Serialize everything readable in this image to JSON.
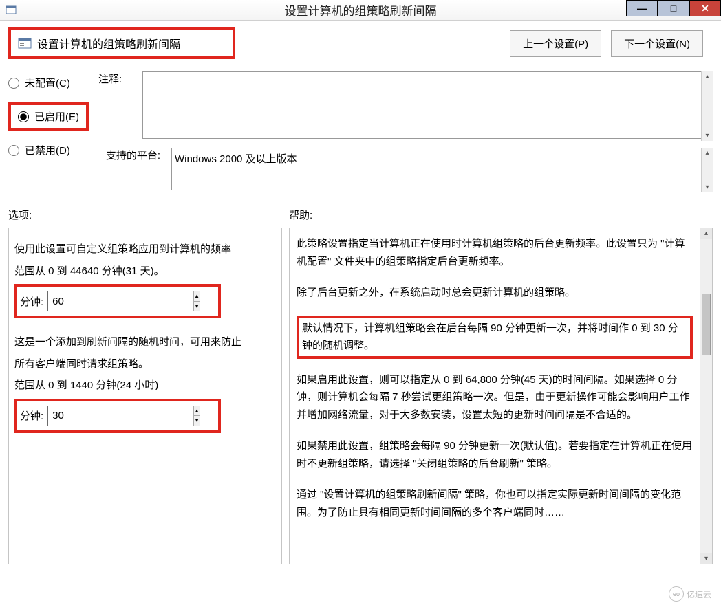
{
  "window": {
    "title": "设置计算机的组策略刷新间隔"
  },
  "header": {
    "policy_name": "设置计算机的组策略刷新间隔",
    "prev_button": "上一个设置(P)",
    "next_button": "下一个设置(N)"
  },
  "state": {
    "not_configured": "未配置(C)",
    "enabled": "已启用(E)",
    "disabled": "已禁用(D)",
    "selected": "enabled"
  },
  "comment": {
    "label": "注释:",
    "value": ""
  },
  "supported": {
    "label": "支持的平台:",
    "value": "Windows 2000 及以上版本"
  },
  "options": {
    "section_label": "选项:",
    "desc1": "使用此设置可自定义组策略应用到计算机的频率",
    "range1": "范围从 0 到 44640 分钟(31 天)。",
    "minute_label": "分钟:",
    "interval_value": "60",
    "desc2": "这是一个添加到刷新间隔的随机时间，可用来防止",
    "desc3": "所有客户端同时请求组策略。",
    "range2": "范围从 0 到 1440 分钟(24 小时)",
    "offset_value": "30"
  },
  "help": {
    "section_label": "帮助:",
    "p1": "此策略设置指定当计算机正在使用时计算机组策略的后台更新频率。此设置只为 \"计算机配置\" 文件夹中的组策略指定后台更新频率。",
    "p2": "除了后台更新之外，在系统启动时总会更新计算机的组策略。",
    "p3_highlight": "默认情况下，计算机组策略会在后台每隔 90 分钟更新一次，并将时间作 0 到 30 分钟的随机调整。",
    "p4": "如果启用此设置，则可以指定从 0 到 64,800 分钟(45 天)的时间间隔。如果选择 0 分钟，则计算机会每隔 7 秒尝试更组策略一次。但是，由于更新操作可能会影响用户工作并增加网络流量，对于大多数安装，设置太短的更新时间间隔是不合适的。",
    "p5": "如果禁用此设置，组策略会每隔 90 分钟更新一次(默认值)。若要指定在计算机正在使用时不更新组策略，请选择 \"关闭组策略的后台刷新\" 策略。",
    "p6": "通过 \"设置计算机的组策略刷新间隔\" 策略，你也可以指定实际更新时间间隔的变化范围。为了防止具有相同更新时间间隔的多个客户端同时……"
  },
  "watermark": "亿速云"
}
